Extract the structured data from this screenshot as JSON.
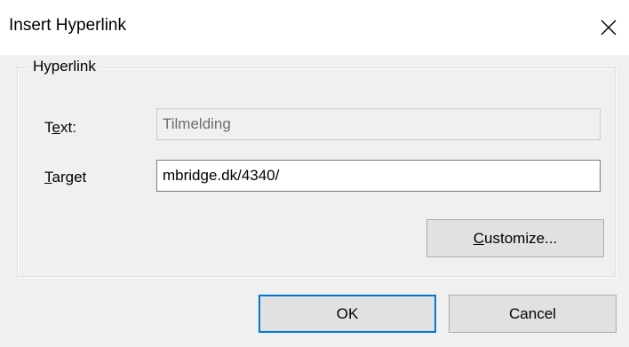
{
  "window": {
    "title": "Insert Hyperlink",
    "close_icon": "close-icon"
  },
  "group": {
    "label": "Hyperlink"
  },
  "fields": {
    "text": {
      "label_before": "T",
      "label_mnemonic": "e",
      "label_after": "xt:",
      "value": "Tilmelding",
      "disabled": true
    },
    "target": {
      "label_before": "",
      "label_mnemonic": "T",
      "label_after": "arget",
      "value": "mbridge.dk/4340/"
    }
  },
  "buttons": {
    "customize": {
      "mnemonic": "C",
      "rest": "ustomize..."
    },
    "ok": {
      "label": "OK"
    },
    "cancel": {
      "label": "Cancel"
    }
  },
  "colors": {
    "accent": "#0078d7",
    "dialog_bg": "#f0f0f0",
    "titlebar_bg": "#ffffff"
  }
}
